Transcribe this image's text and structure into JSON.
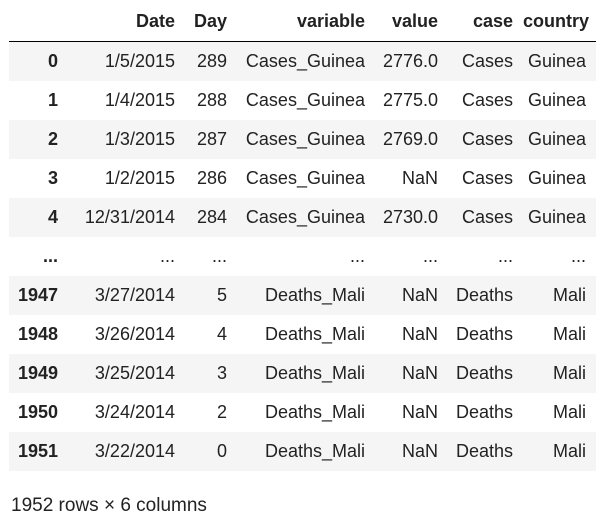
{
  "table": {
    "index_header": "",
    "columns": [
      "Date",
      "Day",
      "variable",
      "value",
      "case",
      "country"
    ],
    "rows": [
      {
        "index": "0",
        "cells": [
          "1/5/2015",
          "289",
          "Cases_Guinea",
          "2776.0",
          "Cases",
          "Guinea"
        ]
      },
      {
        "index": "1",
        "cells": [
          "1/4/2015",
          "288",
          "Cases_Guinea",
          "2775.0",
          "Cases",
          "Guinea"
        ]
      },
      {
        "index": "2",
        "cells": [
          "1/3/2015",
          "287",
          "Cases_Guinea",
          "2769.0",
          "Cases",
          "Guinea"
        ]
      },
      {
        "index": "3",
        "cells": [
          "1/2/2015",
          "286",
          "Cases_Guinea",
          "NaN",
          "Cases",
          "Guinea"
        ]
      },
      {
        "index": "4",
        "cells": [
          "12/31/2014",
          "284",
          "Cases_Guinea",
          "2730.0",
          "Cases",
          "Guinea"
        ]
      },
      {
        "index": "...",
        "cells": [
          "...",
          "...",
          "...",
          "...",
          "...",
          "..."
        ]
      },
      {
        "index": "1947",
        "cells": [
          "3/27/2014",
          "5",
          "Deaths_Mali",
          "NaN",
          "Deaths",
          "Mali"
        ]
      },
      {
        "index": "1948",
        "cells": [
          "3/26/2014",
          "4",
          "Deaths_Mali",
          "NaN",
          "Deaths",
          "Mali"
        ]
      },
      {
        "index": "1949",
        "cells": [
          "3/25/2014",
          "3",
          "Deaths_Mali",
          "NaN",
          "Deaths",
          "Mali"
        ]
      },
      {
        "index": "1950",
        "cells": [
          "3/24/2014",
          "2",
          "Deaths_Mali",
          "NaN",
          "Deaths",
          "Mali"
        ]
      },
      {
        "index": "1951",
        "cells": [
          "3/22/2014",
          "0",
          "Deaths_Mali",
          "NaN",
          "Deaths",
          "Mali"
        ]
      }
    ]
  },
  "footer": {
    "shape_text": "1952 rows × 6 columns"
  },
  "colors": {
    "stripe": "#f5f5f5",
    "text": "#222222",
    "header_rule": "#000000"
  }
}
